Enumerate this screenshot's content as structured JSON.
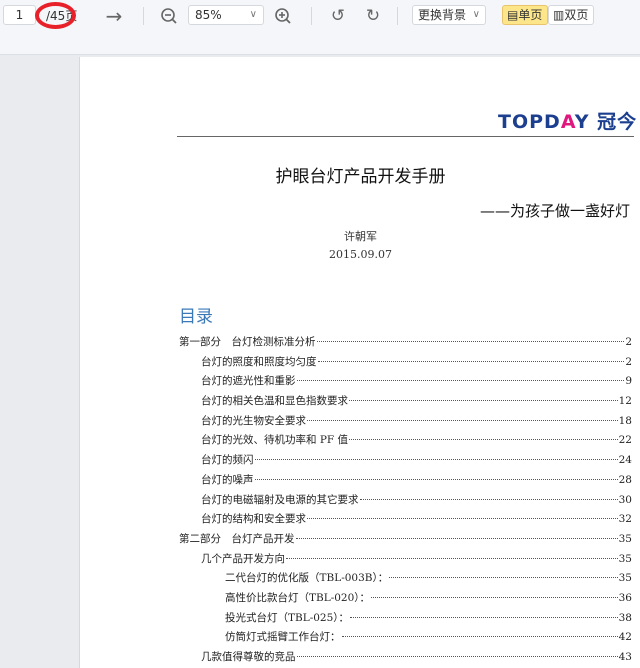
{
  "toolbar": {
    "page_current": "1",
    "page_total": "/45页",
    "zoom": "85%",
    "background_label": "更换背景",
    "single_page": "单页",
    "double_page": "双页"
  },
  "document": {
    "logo": "TOPDAY 冠今",
    "title": "护眼台灯产品开发手册",
    "subtitle": "——为孩子做一盏好灯",
    "author": "许朝军",
    "date": "2015.09.07",
    "toc_heading": "目录",
    "toc": [
      {
        "level": 1,
        "label": "第一部分　台灯检测标准分析",
        "page": "2"
      },
      {
        "level": 2,
        "label": "台灯的照度和照度均匀度",
        "page": "2"
      },
      {
        "level": 2,
        "label": "台灯的遮光性和重影",
        "page": "9"
      },
      {
        "level": 2,
        "label": "台灯的相关色温和显色指数要求",
        "page": "12"
      },
      {
        "level": 2,
        "label": "台灯的光生物安全要求",
        "page": "18"
      },
      {
        "level": 2,
        "label": "台灯的光效、待机功率和 PF 值",
        "page": "22"
      },
      {
        "level": 2,
        "label": "台灯的频闪",
        "page": "24"
      },
      {
        "level": 2,
        "label": "台灯的噪声",
        "page": "28"
      },
      {
        "level": 2,
        "label": "台灯的电磁辐射及电源的其它要求",
        "page": "30"
      },
      {
        "level": 2,
        "label": "台灯的结构和安全要求",
        "page": "32"
      },
      {
        "level": 1,
        "label": "第二部分　台灯产品开发",
        "page": "35"
      },
      {
        "level": 2,
        "label": "几个产品开发方向",
        "page": "35"
      },
      {
        "level": 3,
        "label": "二代台灯的优化版（TBL-003B）：",
        "page": "35"
      },
      {
        "level": 3,
        "label": "高性价比款台灯（TBL-020）：",
        "page": "36"
      },
      {
        "level": 3,
        "label": "投光式台灯（TBL-025）：",
        "page": "38"
      },
      {
        "level": 3,
        "label": "仿筒灯式摇臂工作台灯：",
        "page": "42"
      },
      {
        "level": 2,
        "label": "几款值得尊敬的竞品",
        "page": "43"
      }
    ]
  }
}
